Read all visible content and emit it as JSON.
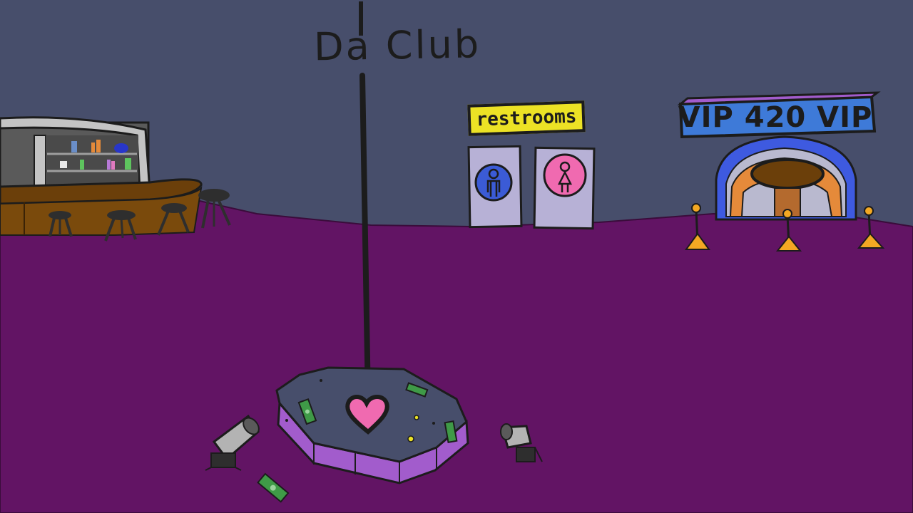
{
  "scene": {
    "title": "Da Club",
    "restroom_sign": "restrooms",
    "vip_sign": "VIP 420 VIP",
    "colors": {
      "wall": "#474e6b",
      "floor": "#621464",
      "stage_top": "#474e6b",
      "stage_side": "#a25ccc",
      "heart": "#f06ab0",
      "restroom_sign": "#ece225",
      "mens_icon": "#3b5bd6",
      "womens_icon": "#f06ab0",
      "vip_sign": "#3e7ad8",
      "bar_counter": "#6b3f0a",
      "rope_post": "#f3a823",
      "cash": "#3f9a47"
    },
    "icons": [
      "mens-restroom-icon",
      "womens-restroom-icon",
      "heart-icon",
      "spotlight-icon",
      "cash-icon"
    ]
  }
}
